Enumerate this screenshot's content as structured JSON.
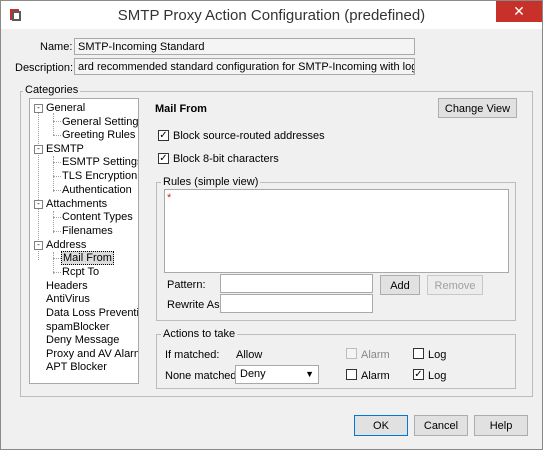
{
  "window": {
    "title": "SMTP Proxy Action Configuration (predefined)",
    "close_glyph": "✕"
  },
  "name_label": "Name:",
  "name_value": "SMTP-Incoming Standard",
  "description_label": "Description:",
  "description_value": "ard recommended standard configuration for SMTP-Incoming with logging enabled",
  "categories": {
    "label": "Categories",
    "tree": [
      {
        "label": "General",
        "expanded": "-"
      },
      {
        "label": "General Settings"
      },
      {
        "label": "Greeting Rules"
      },
      {
        "label": "ESMTP",
        "expanded": "-"
      },
      {
        "label": "ESMTP Settings"
      },
      {
        "label": "TLS Encryption"
      },
      {
        "label": "Authentication"
      },
      {
        "label": "Attachments",
        "expanded": "-"
      },
      {
        "label": "Content Types"
      },
      {
        "label": "Filenames"
      },
      {
        "label": "Address",
        "expanded": "-"
      },
      {
        "label": "Mail From",
        "selected": true
      },
      {
        "label": "Rcpt To"
      },
      {
        "label": "Headers"
      },
      {
        "label": "AntiVirus"
      },
      {
        "label": "Data Loss Prevention"
      },
      {
        "label": "spamBlocker"
      },
      {
        "label": "Deny Message"
      },
      {
        "label": "Proxy and AV Alarms"
      },
      {
        "label": "APT Blocker"
      }
    ]
  },
  "panel": {
    "heading": "Mail From",
    "change_view_label": "Change View",
    "block_source_routed_label": "Block source-routed addresses",
    "block_source_routed_checked": true,
    "block_8bit_label": "Block 8-bit characters",
    "block_8bit_checked": true,
    "rules_label": "Rules (simple view)",
    "rules_list": [
      "*"
    ],
    "pattern_label": "Pattern:",
    "pattern_value": "",
    "add_label": "Add",
    "remove_label": "Remove",
    "rewrite_label": "Rewrite As:",
    "rewrite_value": ""
  },
  "actions": {
    "label": "Actions to take",
    "if_matched_label": "If matched:",
    "if_matched_value": "Allow",
    "none_matched_label": "None matched:",
    "none_matched_value": "Deny",
    "alarm_label": "Alarm",
    "log_label": "Log",
    "if_matched_alarm": false,
    "if_matched_log": false,
    "none_matched_alarm": false,
    "none_matched_log": true
  },
  "footer": {
    "ok_label": "OK",
    "cancel_label": "Cancel",
    "help_label": "Help"
  }
}
